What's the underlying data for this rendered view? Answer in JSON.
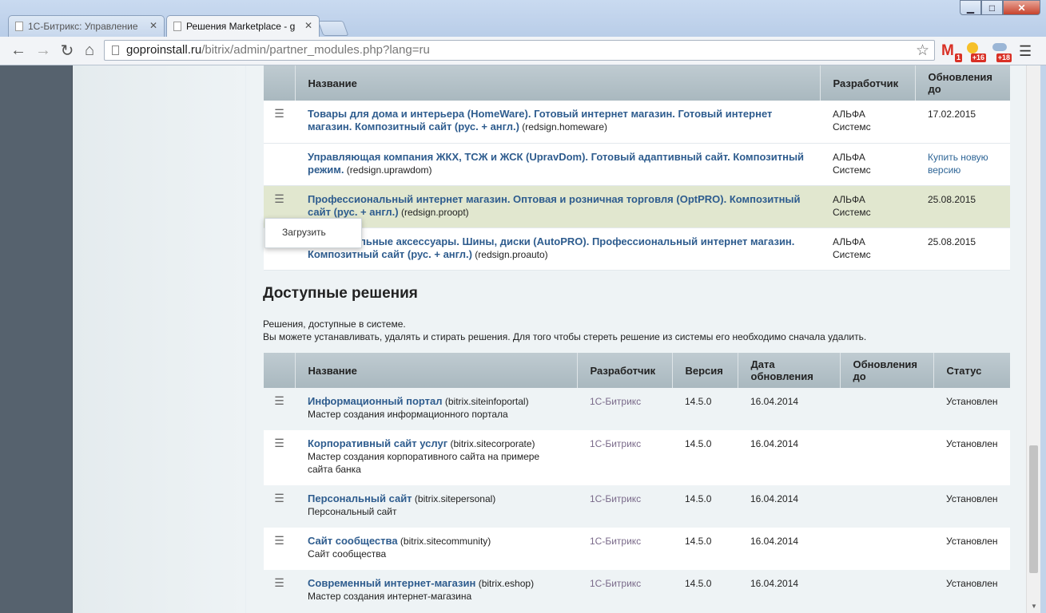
{
  "browser": {
    "tabs": [
      {
        "title": "1С-Битрикс: Управление"
      },
      {
        "title": "Решения Marketplace - g"
      }
    ],
    "url_host": "goproinstall.ru",
    "url_path": "/bitrix/admin/partner_modules.php?lang=ru",
    "extensions": {
      "gmail_badge": "1",
      "weather1_badge": "+16",
      "weather2_badge": "+18"
    }
  },
  "updates_table": {
    "headers": {
      "name": "Название",
      "developer": "Разработчик",
      "updates": "Обновления до"
    },
    "rows": [
      {
        "title": "Товары для дома и интерьера (HomeWare). Готовый интернет магазин. Готовый интернет магазин. Композитный сайт (рус. + англ.)",
        "code": "(redsign.homeware)",
        "developer": "АЛЬФА Системс",
        "updates": "17.02.2015"
      },
      {
        "title": "Управляющая компания ЖКХ, ТСЖ и ЖСК (UpravDom). Готовый адаптивный сайт. Композитный режим.",
        "code": "(redsign.uprawdom)",
        "developer": "АЛЬФА Системс",
        "updates": "Купить новую версию"
      },
      {
        "title": "Профессиональный интернет магазин. Оптовая и розничная торговля (OptPRO). Композитный сайт (рус. + англ.)",
        "code": "(redsign.proopt)",
        "developer": "АЛЬФА Системс",
        "updates": "25.08.2015"
      },
      {
        "title": "Автомобильные аксессуары. Шины, диски (AutoPRO). Профессиональный интернет магазин. Композитный сайт (рус. + англ.)",
        "code": "(redsign.proauto)",
        "developer": "АЛЬФА Системс",
        "updates": "25.08.2015"
      }
    ]
  },
  "context_menu": {
    "item": "Загрузить"
  },
  "available": {
    "title": "Доступные решения",
    "desc_line1": "Решения, доступные в системе.",
    "desc_line2": "Вы можете устанавливать, удалять и стирать решения. Для того чтобы стереть решение из системы его необходимо сначала удалить.",
    "headers": {
      "name": "Название",
      "developer": "Разработчик",
      "version": "Версия",
      "date": "Дата обновления",
      "updates": "Обновления до",
      "status": "Статус"
    },
    "rows": [
      {
        "title": "Информационный портал",
        "code": "(bitrix.siteinfoportal)",
        "desc": "Мастер создания информационного портала",
        "developer": "1С-Битрикс",
        "version": "14.5.0",
        "date": "16.04.2014",
        "updates": "",
        "status": "Установлен"
      },
      {
        "title": "Корпоративный сайт услуг",
        "code": "(bitrix.sitecorporate)",
        "desc": "Мастер создания корпоративного сайта на примере сайта банка",
        "developer": "1С-Битрикс",
        "version": "14.5.0",
        "date": "16.04.2014",
        "updates": "",
        "status": "Установлен"
      },
      {
        "title": "Персональный сайт",
        "code": "(bitrix.sitepersonal)",
        "desc": "Персональный сайт",
        "developer": "1С-Битрикс",
        "version": "14.5.0",
        "date": "16.04.2014",
        "updates": "",
        "status": "Установлен"
      },
      {
        "title": "Сайт сообщества",
        "code": "(bitrix.sitecommunity)",
        "desc": "Сайт сообщества",
        "developer": "1С-Битрикс",
        "version": "14.5.0",
        "date": "16.04.2014",
        "updates": "",
        "status": "Установлен"
      },
      {
        "title": "Современный интернет-магазин",
        "code": "(bitrix.eshop)",
        "desc": "Мастер создания интернет-магазина",
        "developer": "1С-Битрикс",
        "version": "14.5.0",
        "date": "16.04.2014",
        "updates": "",
        "status": "Установлен"
      }
    ]
  }
}
